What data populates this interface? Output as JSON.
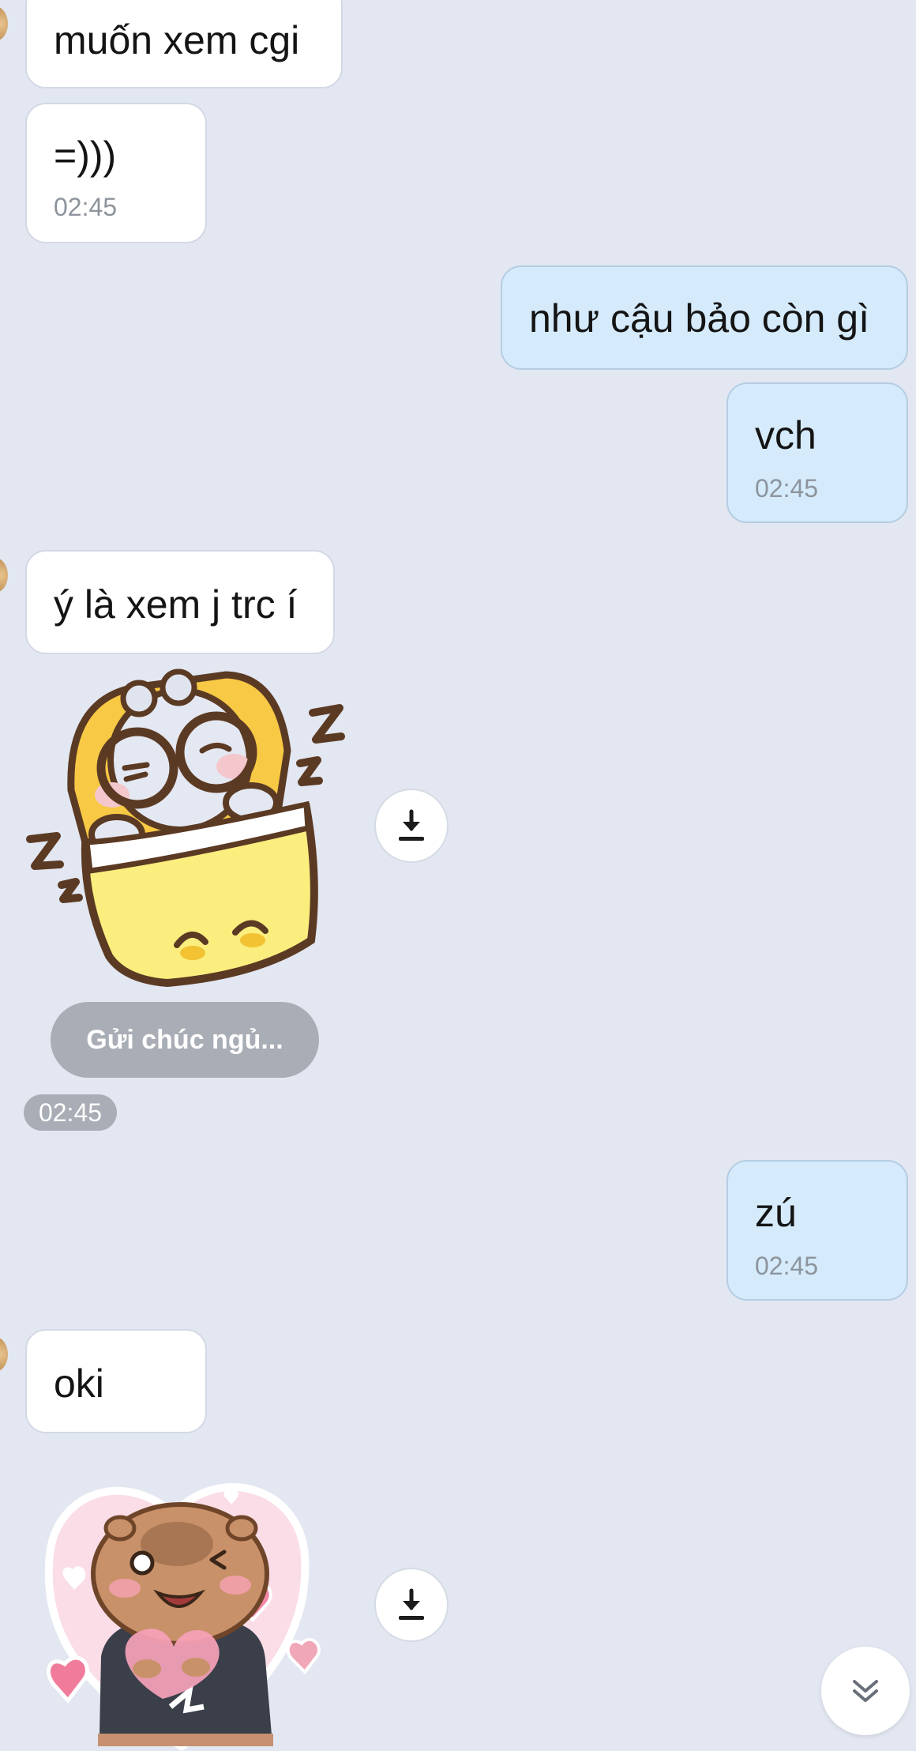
{
  "messages": {
    "m1": {
      "text": "muốn xem cgi"
    },
    "m2": {
      "text": "=)))",
      "time": "02:45"
    },
    "m3": {
      "text": "như cậu bảo còn gì"
    },
    "m4": {
      "text": "vch",
      "time": "02:45"
    },
    "m5": {
      "text": "ý là xem j trc í"
    },
    "m6": {
      "suggestion": "Gửi chúc ngủ...",
      "time": "02:45"
    },
    "m7": {
      "text": "zú",
      "time": "02:45"
    },
    "m8": {
      "text": "oki"
    }
  },
  "icons": {
    "download": "download-icon",
    "scroll_down": "double-chevron-down-icon",
    "sleep_sticker": "sleeping-bear-sticker",
    "heart_sticker": "capybara-heart-sticker"
  },
  "colors": {
    "background": "#e2e7f1",
    "incoming_bubble": "#ffffff",
    "outgoing_bubble": "#d5ebfc",
    "timestamp": "#8d949c",
    "suggestion_chip": "#a9adb5"
  }
}
